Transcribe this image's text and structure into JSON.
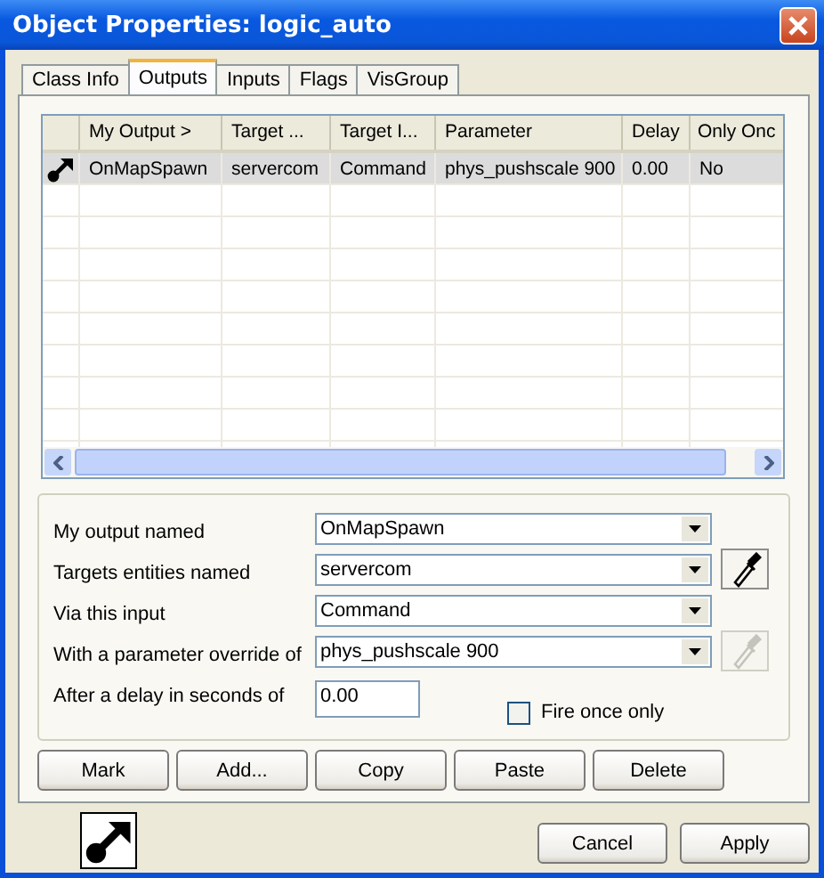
{
  "window": {
    "title": "Object Properties: logic_auto"
  },
  "tabs": [
    {
      "label": "Class Info",
      "selected": false
    },
    {
      "label": "Outputs",
      "selected": true
    },
    {
      "label": "Inputs",
      "selected": false
    },
    {
      "label": "Flags",
      "selected": false
    },
    {
      "label": "VisGroup",
      "selected": false
    }
  ],
  "table": {
    "columns": [
      "My Output >",
      "Target ...",
      "Target I...",
      "Parameter",
      "Delay",
      "Only Onc"
    ],
    "rows": [
      {
        "selected": true,
        "cells": [
          "OnMapSpawn",
          "servercom",
          "Command",
          "phys_pushscale 900",
          "0.00",
          "No"
        ]
      }
    ]
  },
  "fields": [
    {
      "kind": "combo",
      "label": "My output named",
      "value": "OnMapSpawn"
    },
    {
      "kind": "combo",
      "label": "Targets entities named",
      "value": "servercom",
      "picker": {
        "disabled": false
      }
    },
    {
      "kind": "combo",
      "label": "Via this input",
      "value": "Command"
    },
    {
      "kind": "combo",
      "label": "With a parameter override of",
      "value": "phys_pushscale 900",
      "picker": {
        "disabled": true
      }
    },
    {
      "kind": "text",
      "label": "After a delay in seconds of",
      "value": "0.00"
    }
  ],
  "fire_once": {
    "label": "Fire once only",
    "checked": false
  },
  "actions": [
    "Mark",
    "Add...",
    "Copy",
    "Paste",
    "Delete"
  ],
  "footer_buttons": [
    "Cancel",
    "Apply"
  ]
}
